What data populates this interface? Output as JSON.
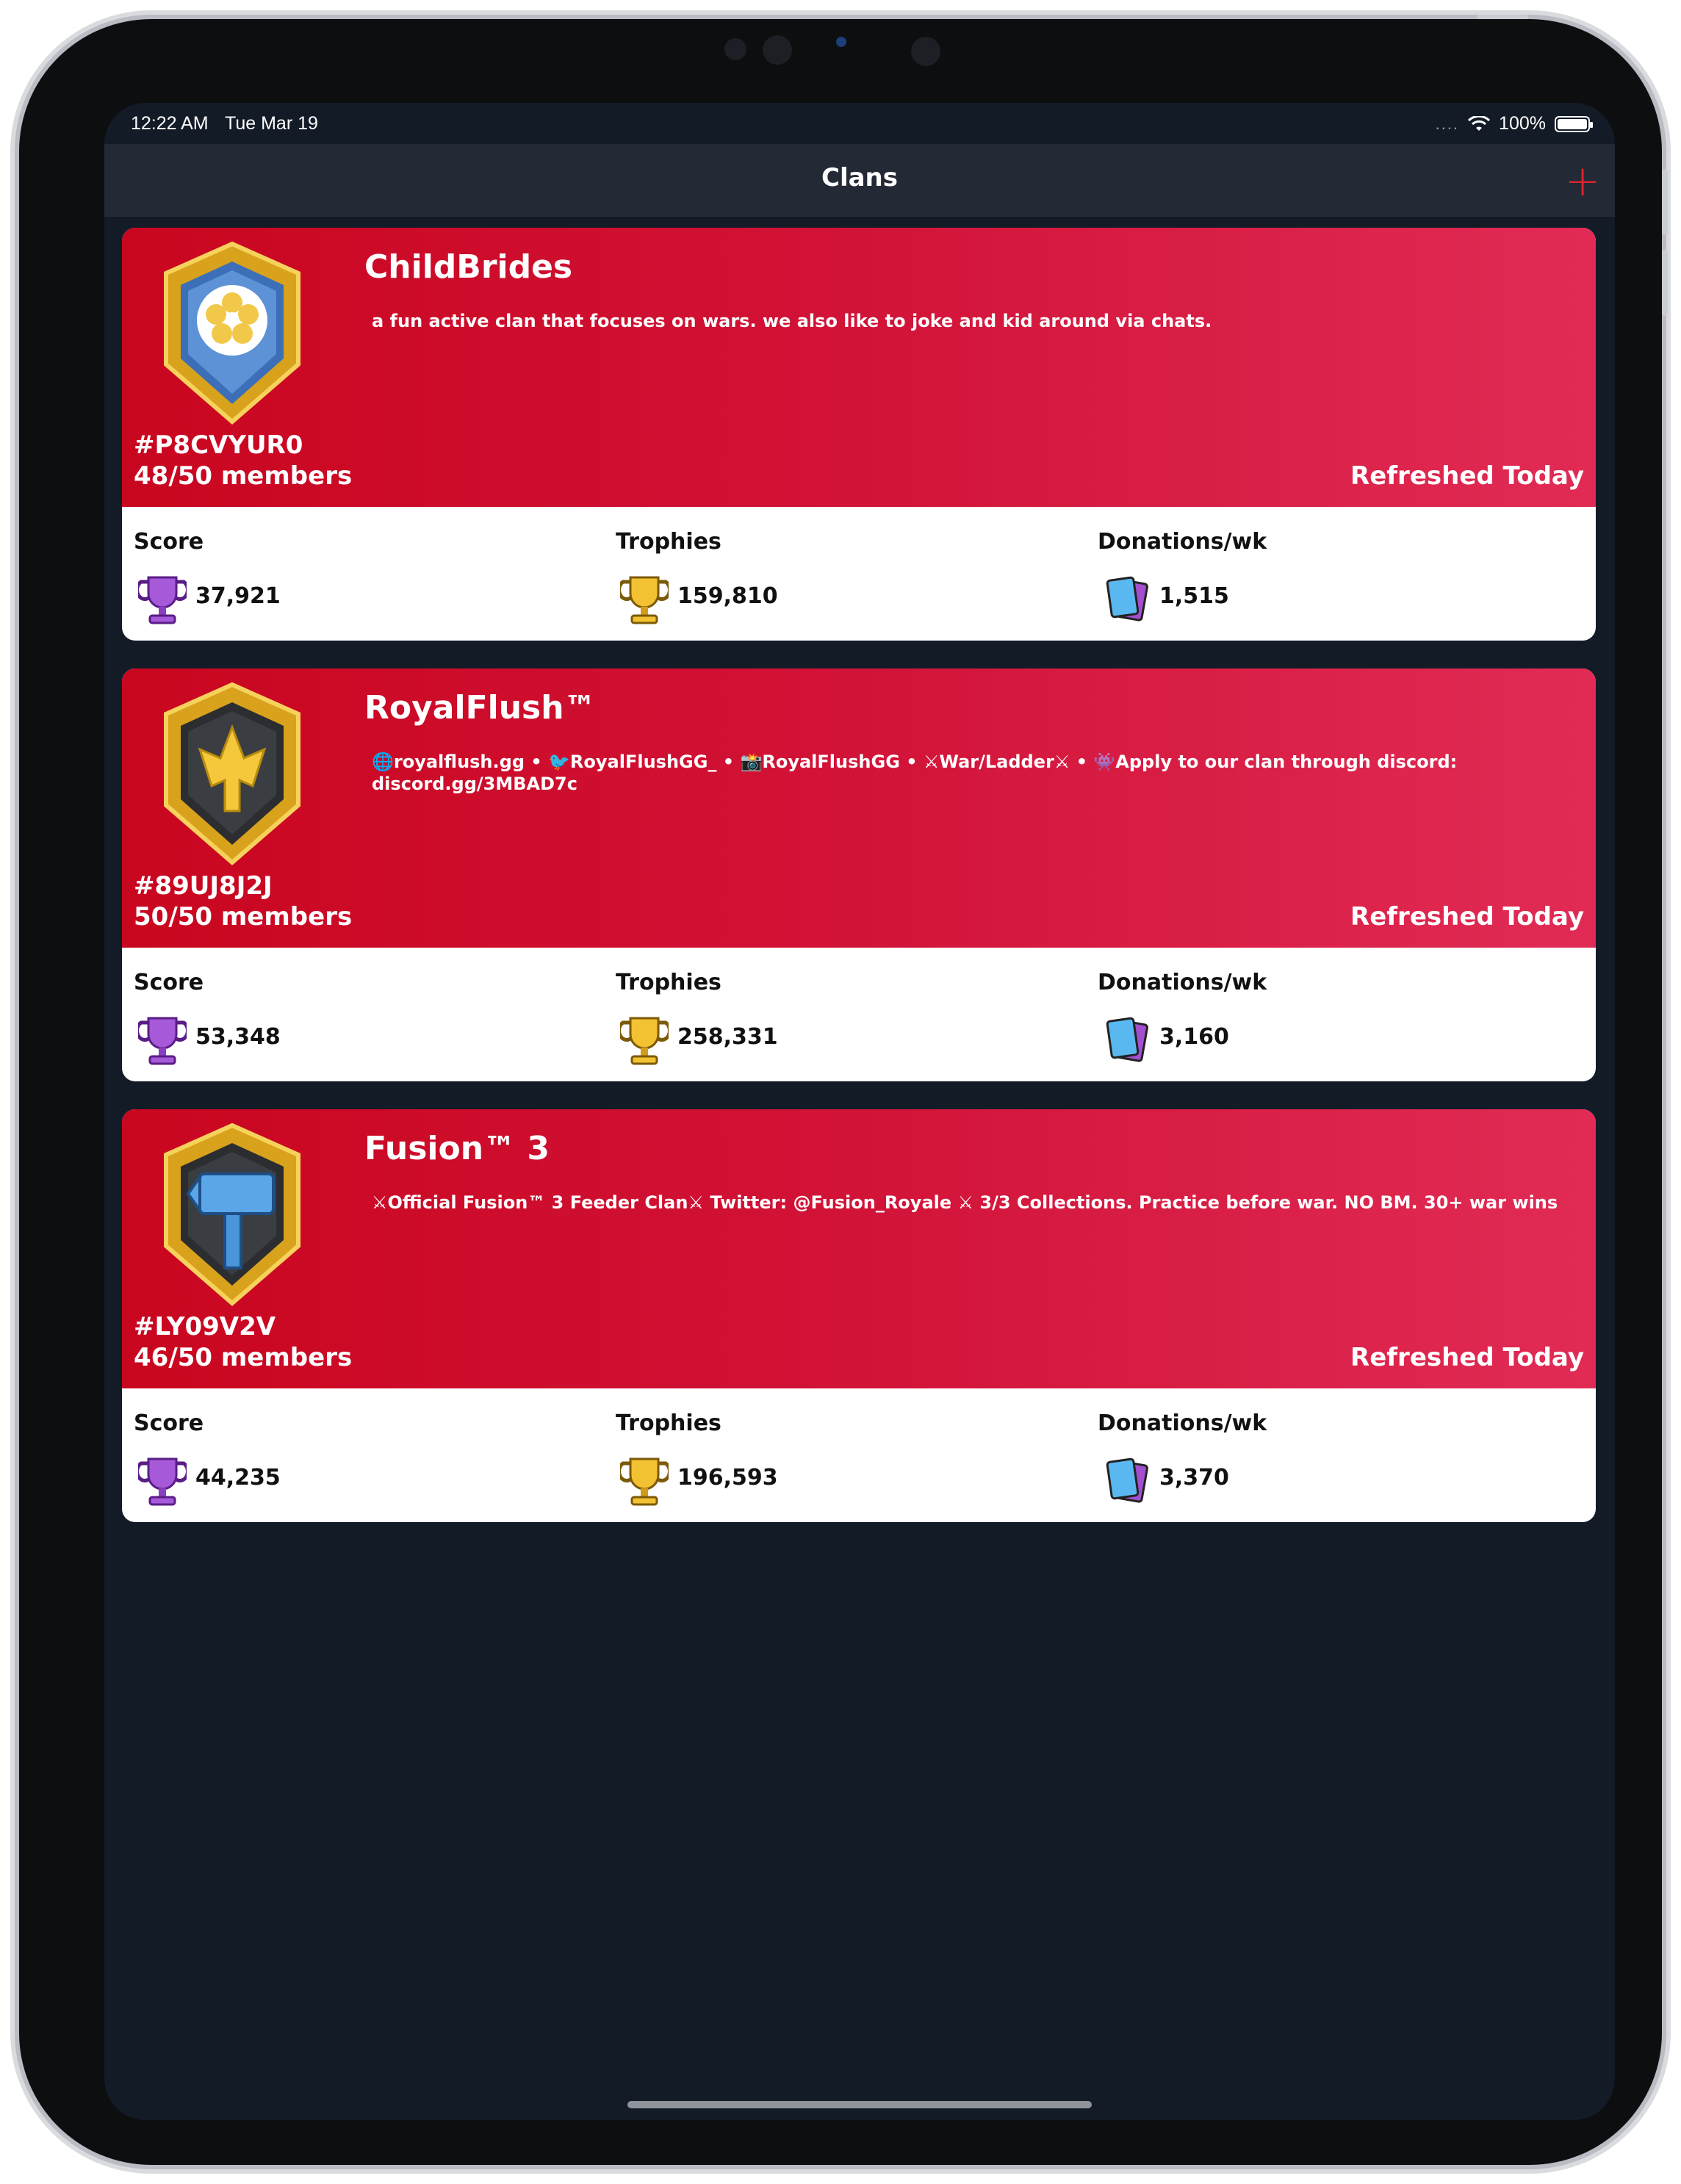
{
  "status_bar": {
    "time": "12:22 AM",
    "date": "Tue Mar 19",
    "signal": "....",
    "battery": "100%"
  },
  "nav": {
    "title": "Clans",
    "add_label": "+"
  },
  "stat_labels": {
    "score": "Score",
    "trophies": "Trophies",
    "donations": "Donations/wk"
  },
  "clans": [
    {
      "name": "ChildBrides",
      "description": "a fun active clan that focuses on wars. we also like to joke and kid around via chats.",
      "tag": "#P8CVYUR0",
      "members": "48/50 members",
      "refreshed": "Refreshed Today",
      "score": "37,921",
      "trophies": "159,810",
      "donations": "1,515",
      "badge_icon": "flower-badge-icon"
    },
    {
      "name": "RoyalFlush™",
      "description": "🌐royalflush.gg • 🐦RoyalFlushGG_ • 📸RoyalFlushGG • ⚔War/Ladder⚔ • 👾Apply to our clan through discord: discord.gg/3MBAD7c",
      "tag": "#89UJ8J2J",
      "members": "50/50 members",
      "refreshed": "Refreshed Today",
      "score": "53,348",
      "trophies": "258,331",
      "donations": "3,160",
      "badge_icon": "crown-badge-icon"
    },
    {
      "name": "Fusion™ 3",
      "description": "⚔Official Fusion™ 3 Feeder Clan⚔ Twitter: @Fusion_Royale ⚔ 3/3 Collections. Practice before war. NO BM. 30+ war wins",
      "tag": "#LY09V2V",
      "members": "46/50 members",
      "refreshed": "Refreshed Today",
      "score": "44,235",
      "trophies": "196,593",
      "donations": "3,370",
      "badge_icon": "hammer-badge-icon"
    }
  ],
  "colors": {
    "accent": "#e0222c",
    "card_gradient_start": "#c9061f",
    "card_gradient_end": "#e12b55",
    "background": "#131b27"
  }
}
